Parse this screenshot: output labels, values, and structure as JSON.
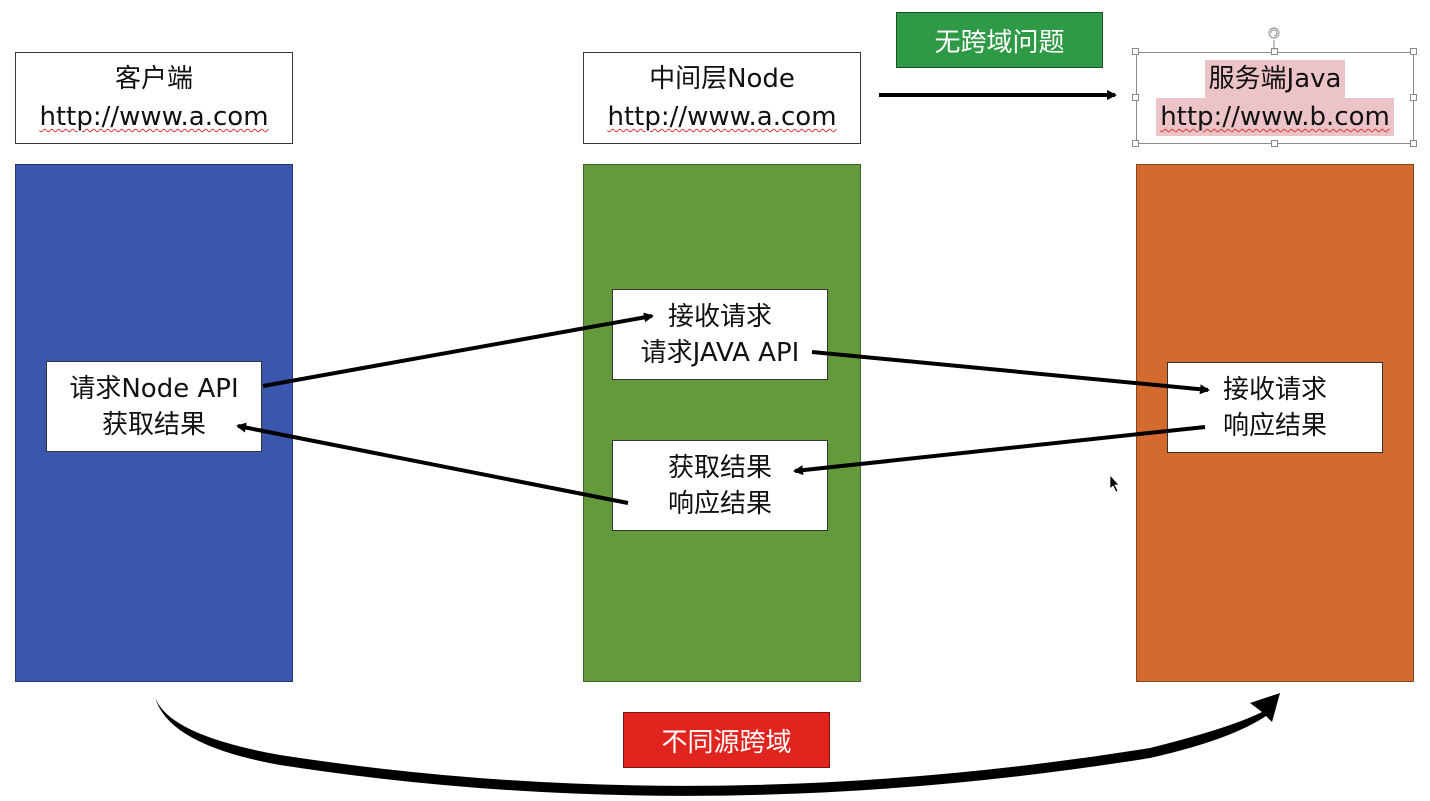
{
  "colors": {
    "client": "#3a57ad",
    "node": "#659a3c",
    "server": "#d36b2f",
    "tag_green": "#2e9a45",
    "tag_red": "#e1241d",
    "highlight": "#ecc4c8"
  },
  "client": {
    "title": "客户端",
    "url": "http://www.a.com",
    "action_line1": "请求Node API",
    "action_line2": "获取结果"
  },
  "node": {
    "title": "中间层Node",
    "url": "http://www.a.com",
    "receive_line1": "接收请求",
    "receive_line2": "请求JAVA API",
    "result_line1": "获取结果",
    "result_line2": "响应结果"
  },
  "server": {
    "title": "服务端Java",
    "url": "http://www.b.com",
    "action_line1": "接收请求",
    "action_line2": "响应结果"
  },
  "tags": {
    "no_cors": "无跨域问题",
    "cross_origin": "不同源跨域"
  },
  "icons": {
    "rotate_handle": "rotate-handle-icon",
    "cursor": "mouse-pointer-icon"
  }
}
